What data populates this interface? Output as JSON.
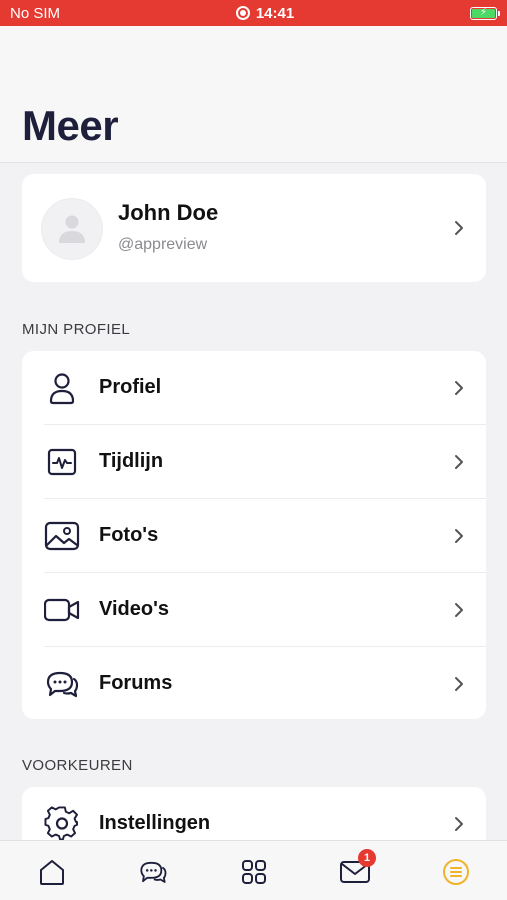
{
  "status_bar": {
    "carrier": "No SIM",
    "time": "14:41"
  },
  "page": {
    "title": "Meer"
  },
  "profile": {
    "name": "John Doe",
    "handle": "@appreview"
  },
  "sections": {
    "profile_label": "MIJN PROFIEL",
    "preferences_label": "VOORKEUREN"
  },
  "menu": {
    "items": [
      {
        "label": "Profiel",
        "icon": "user-icon"
      },
      {
        "label": "Tijdlijn",
        "icon": "activity-icon"
      },
      {
        "label": "Foto's",
        "icon": "image-icon"
      },
      {
        "label": "Video's",
        "icon": "video-icon"
      },
      {
        "label": "Forums",
        "icon": "chat-icon"
      }
    ],
    "preferences": [
      {
        "label": "Instellingen",
        "icon": "gear-icon"
      }
    ]
  },
  "tabbar": {
    "tabs": [
      {
        "icon": "home-icon"
      },
      {
        "icon": "chat-icon"
      },
      {
        "icon": "grid-icon"
      },
      {
        "icon": "mail-icon",
        "badge": "1"
      },
      {
        "icon": "menu-icon",
        "active": true
      }
    ]
  },
  "colors": {
    "accent": "#f0b429",
    "navy": "#1e1f3b",
    "status_red": "#e43a31"
  }
}
